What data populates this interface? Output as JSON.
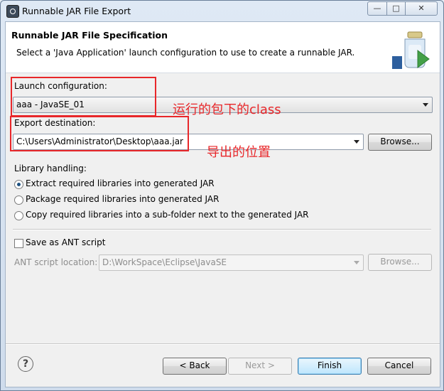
{
  "window": {
    "title": "Runnable JAR File Export",
    "minimize_symbol": "—",
    "maximize_symbol": "□",
    "close_symbol": "✕"
  },
  "header": {
    "title": "Runnable JAR File Specification",
    "description": "Select a 'Java Application' launch configuration to use to create a runnable JAR.",
    "icon": "jar-wizard-icon"
  },
  "launch": {
    "label": "Launch configuration:",
    "value": "aaa - JavaSE_01"
  },
  "export": {
    "label": "Export destination:",
    "value": "C:\\Users\\Administrator\\Desktop\\aaa.jar",
    "browse_label": "Browse..."
  },
  "library": {
    "label": "Library handling:",
    "options": [
      "Extract required libraries into generated JAR",
      "Package required libraries into generated JAR",
      "Copy required libraries into a sub-folder next to the generated JAR"
    ],
    "selected_index": 0
  },
  "ant": {
    "save_label": "Save as ANT script",
    "checked": false,
    "location_label": "ANT script location:",
    "location_value": "D:\\WorkSpace\\Eclipse\\JavaSE",
    "browse_label": "Browse..."
  },
  "annotations": {
    "launch_note": "运行的包下的class",
    "export_note": "导出的位置",
    "color": "#e8272a"
  },
  "footer": {
    "help_symbol": "?",
    "back_label": "< Back",
    "next_label": "Next >",
    "finish_label": "Finish",
    "cancel_label": "Cancel"
  }
}
